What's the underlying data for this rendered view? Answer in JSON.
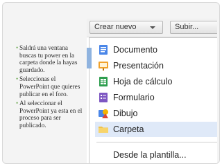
{
  "slide": {
    "bullets": [
      "Saldrá una ventana buscas tu power en la carpeta donde la hayas guardado.",
      "Seleccionas el PowerPoint que quieres publicar en el foro.",
      "Al seleccionar el PowerPoint ya esta en el proceso para ser publicado."
    ]
  },
  "toolbar": {
    "crear_label": "Crear nuevo",
    "subir_label": "Subir..."
  },
  "menu": {
    "items": [
      {
        "label": "Documento",
        "icon": "document-icon"
      },
      {
        "label": "Presentación",
        "icon": "presentation-icon"
      },
      {
        "label": "Hoja de cálculo",
        "icon": "spreadsheet-icon"
      },
      {
        "label": "Formulario",
        "icon": "form-icon"
      },
      {
        "label": "Dibujo",
        "icon": "drawing-icon"
      },
      {
        "label": "Carpeta",
        "icon": "folder-icon"
      },
      {
        "label": "Desde la plantilla..."
      }
    ],
    "highlighted": "Carpeta"
  },
  "colors": {
    "bullet_marker": "#6aa84f",
    "highlight": "#dfe9f8"
  }
}
